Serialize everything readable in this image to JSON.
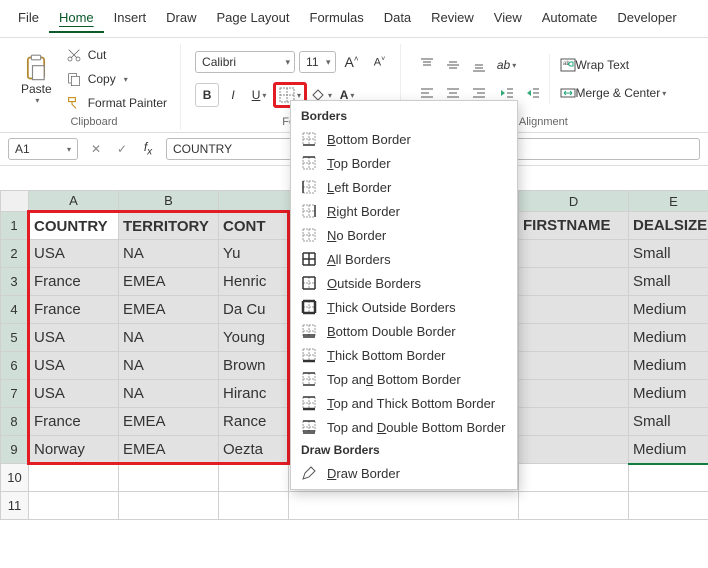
{
  "menubar": {
    "items": [
      "File",
      "Home",
      "Insert",
      "Draw",
      "Page Layout",
      "Formulas",
      "Data",
      "Review",
      "View",
      "Automate",
      "Developer"
    ],
    "active": 1
  },
  "ribbon": {
    "clipboard": {
      "paste": "Paste",
      "cut": "Cut",
      "copy": "Copy",
      "format_painter": "Format Painter",
      "label": "Clipboard"
    },
    "font": {
      "name": "Calibri",
      "size": "11",
      "bold": "B",
      "italic": "I",
      "underline": "U",
      "label": "Font",
      "increase": "A",
      "decrease": "A"
    },
    "alignment": {
      "wrap": "Wrap Text",
      "merge": "Merge & Center",
      "label": "Alignment"
    }
  },
  "formula_bar": {
    "name_box": "A1",
    "value": "COUNTRY"
  },
  "grid": {
    "cols": [
      "A",
      "B",
      "C",
      "D",
      "E"
    ],
    "rows_visible": 11,
    "headers": [
      "COUNTRY",
      "TERRITORY",
      "CONT",
      "FIRSTNAME",
      "DEALSIZE"
    ],
    "data": [
      [
        "USA",
        "NA",
        "Yu",
        "",
        "Small"
      ],
      [
        "France",
        "EMEA",
        "Henric",
        "",
        "Small"
      ],
      [
        "France",
        "EMEA",
        "Da Cu",
        "",
        "Medium"
      ],
      [
        "USA",
        "NA",
        "Young",
        "",
        "Medium"
      ],
      [
        "USA",
        "NA",
        "Brown",
        "",
        "Medium"
      ],
      [
        "USA",
        "NA",
        "Hiranc",
        "",
        "Medium"
      ],
      [
        "France",
        "EMEA",
        "Rance",
        "",
        "Small"
      ],
      [
        "Norway",
        "EMEA",
        "Oezta",
        "",
        "Medium"
      ]
    ]
  },
  "borders_menu": {
    "title": "Borders",
    "items": [
      "Bottom Border",
      "Top Border",
      "Left Border",
      "Right Border",
      "No Border",
      "All Borders",
      "Outside Borders",
      "Thick Outside Borders",
      "Bottom Double Border",
      "Thick Bottom Border",
      "Top and Bottom Border",
      "Top and Thick Bottom Border",
      "Top and Double Bottom Border"
    ],
    "draw_title": "Draw Borders",
    "draw_items": [
      "Draw Border"
    ]
  }
}
